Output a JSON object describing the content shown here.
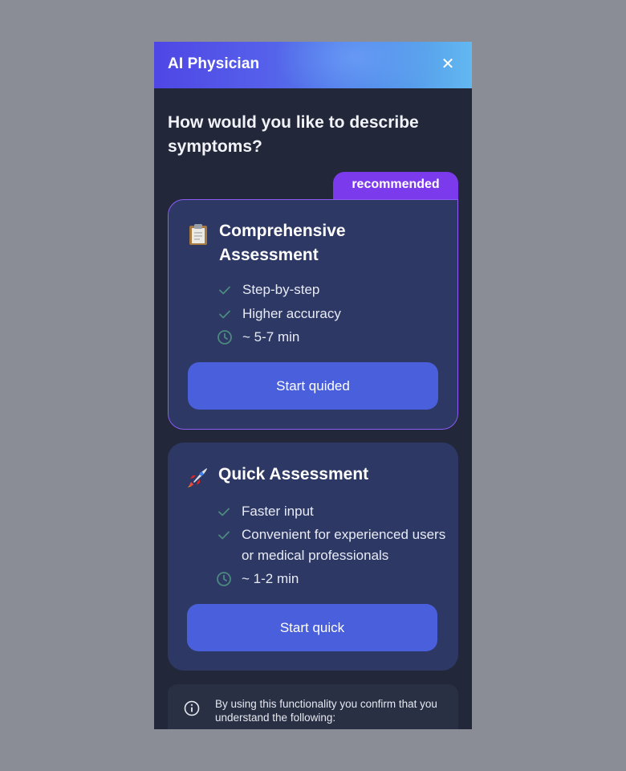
{
  "header": {
    "title": "AI Physician",
    "close_icon": "close-icon"
  },
  "question": "How would you like to describe symptoms?",
  "recommended_badge": "recommended",
  "options": [
    {
      "icon": "clipboard-icon",
      "title": "Comprehensive Assessment",
      "features": [
        {
          "icon": "check-icon",
          "text": "Step-by-step"
        },
        {
          "icon": "check-icon",
          "text": "Higher accuracy"
        },
        {
          "icon": "clock-icon",
          "text": "~ 5-7 min"
        }
      ],
      "button": "Start quided"
    },
    {
      "icon": "rocket-icon",
      "title": "Quick Assessment",
      "features": [
        {
          "icon": "check-icon",
          "text": "Faster input"
        },
        {
          "icon": "check-icon",
          "text": "Convenient for experienced users or medical professionals"
        },
        {
          "icon": "clock-icon",
          "text": "~ 1-2 min"
        }
      ],
      "button": "Start quick"
    }
  ],
  "disclaimer": {
    "icon": "info-icon",
    "text": "By using this functionality you confirm that you understand the following:"
  },
  "colors": {
    "accent_purple": "#7c3aed",
    "button_blue": "#4a5fdc",
    "card_bg": "#2d3864",
    "panel_bg": "#22273a",
    "icon_teal": "#4c8a80"
  }
}
